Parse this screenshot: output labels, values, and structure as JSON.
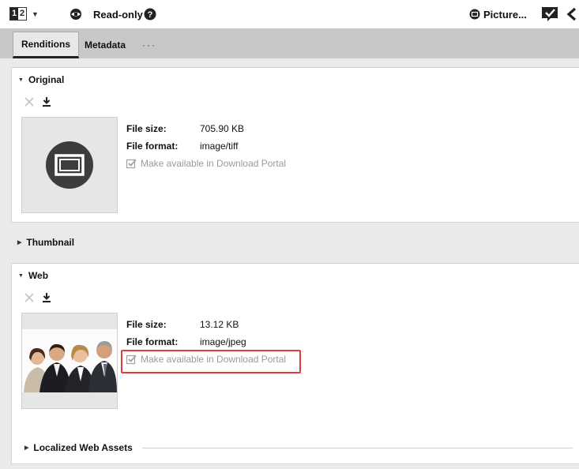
{
  "toolbar": {
    "page_numbers": [
      "1",
      "2"
    ],
    "readonly_label": "Read-only",
    "picture_label": "Picture..."
  },
  "tabs": [
    {
      "label": "Renditions",
      "active": true
    },
    {
      "label": "Metadata",
      "active": false
    },
    {
      "label": "···",
      "active": false
    }
  ],
  "sections": {
    "original": {
      "title": "Original",
      "file_size_label": "File size:",
      "file_size": "705.90 KB",
      "file_format_label": "File format:",
      "file_format": "image/tiff",
      "portal_label": "Make available in Download Portal"
    },
    "thumbnail": {
      "title": "Thumbnail"
    },
    "web": {
      "title": "Web",
      "file_size_label": "File size:",
      "file_size": "13.12 KB",
      "file_format_label": "File format:",
      "file_format": "image/jpeg",
      "portal_label": "Make available in Download Portal",
      "localized_title": "Localized Web Assets"
    }
  },
  "colors": {
    "highlight": "#e53a3a",
    "tabbar": "#c8c8c8",
    "muted": "#9a9a9a"
  },
  "icons": [
    "page-number-icon",
    "lock-icon",
    "help-icon",
    "picture-icon",
    "checkmark-icon",
    "back-icon",
    "delete-icon",
    "download-icon",
    "placeholder-picture-icon",
    "checkbox-icon"
  ]
}
